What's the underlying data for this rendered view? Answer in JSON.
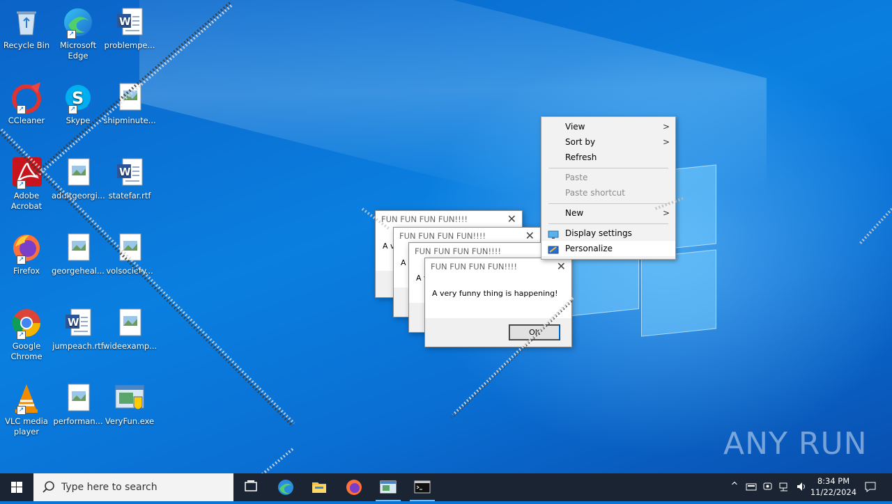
{
  "desktop_icons": [
    {
      "id": "recycle-bin",
      "label": "Recycle Bin",
      "icon": "recycle-bin-icon",
      "shortcut": false
    },
    {
      "id": "edge",
      "label": "Microsoft Edge",
      "icon": "edge-icon",
      "shortcut": true
    },
    {
      "id": "problempe",
      "label": "problempe...",
      "icon": "word-doc-icon",
      "shortcut": false
    },
    {
      "id": "ccleaner",
      "label": "CCleaner",
      "icon": "ccleaner-icon",
      "shortcut": true
    },
    {
      "id": "skype",
      "label": "Skype",
      "icon": "skype-icon",
      "shortcut": true
    },
    {
      "id": "shipminute",
      "label": "shipminute...",
      "icon": "image-file-icon",
      "shortcut": false
    },
    {
      "id": "acrobat",
      "label": "Adobe Acrobat",
      "icon": "acrobat-icon",
      "shortcut": true
    },
    {
      "id": "adultgeorgi",
      "label": "adultgeorgi...",
      "icon": "image-file-icon",
      "shortcut": false
    },
    {
      "id": "statefar",
      "label": "statefar.rtf",
      "icon": "word-doc-icon",
      "shortcut": false
    },
    {
      "id": "firefox",
      "label": "Firefox",
      "icon": "firefox-icon",
      "shortcut": true
    },
    {
      "id": "georgeheal",
      "label": "georgeheal...",
      "icon": "image-file-icon",
      "shortcut": false
    },
    {
      "id": "volsociety",
      "label": "volsociety...",
      "icon": "image-file-icon",
      "shortcut": false
    },
    {
      "id": "chrome",
      "label": "Google Chrome",
      "icon": "chrome-icon",
      "shortcut": true
    },
    {
      "id": "jumpeach",
      "label": "jumpeach.rtf",
      "icon": "word-doc-icon",
      "shortcut": false
    },
    {
      "id": "wideexamp",
      "label": "wideexamp...",
      "icon": "image-file-icon",
      "shortcut": false
    },
    {
      "id": "vlc",
      "label": "VLC media player",
      "icon": "vlc-icon",
      "shortcut": true
    },
    {
      "id": "performan",
      "label": "performan...",
      "icon": "image-file-icon",
      "shortcut": false
    },
    {
      "id": "veryfun",
      "label": "VeryFun.exe",
      "icon": "exe-icon",
      "shortcut": false
    }
  ],
  "dialogs": [
    {
      "title": "FUN FUN FUN FUN!!!!",
      "message": "A v"
    },
    {
      "title": "FUN FUN FUN FUN!!!!",
      "message": "A v"
    },
    {
      "title": "FUN FUN FUN FUN!!!!",
      "message": "A v"
    },
    {
      "title": "FUN FUN FUN FUN!!!!",
      "message": "A very funny thing is happening!",
      "ok_label": "OK"
    }
  ],
  "context_menu": {
    "items": [
      {
        "label": "View",
        "submenu": true,
        "disabled": false
      },
      {
        "label": "Sort by",
        "submenu": true,
        "disabled": false
      },
      {
        "label": "Refresh",
        "submenu": false,
        "disabled": false
      },
      {
        "label": "Paste",
        "submenu": false,
        "disabled": true
      },
      {
        "label": "Paste shortcut",
        "submenu": false,
        "disabled": true
      },
      {
        "label": "New",
        "submenu": true,
        "disabled": false
      },
      {
        "label": "Display settings",
        "submenu": false,
        "disabled": false,
        "icon": "monitor-icon"
      },
      {
        "label": "Personalize",
        "submenu": false,
        "disabled": false,
        "icon": "personalize-icon",
        "highlighted": true
      }
    ]
  },
  "taskbar": {
    "search_placeholder": "Type here to search",
    "apps": [
      "task-view-icon",
      "edge-icon",
      "file-explorer-icon",
      "firefox-icon",
      "veryfun-app-icon",
      "cmd-icon"
    ],
    "time": "8:34 PM",
    "date": "11/22/2024"
  },
  "watermark": "ANY RUN",
  "colors": {
    "accent": "#0078d7",
    "taskbar": "#1b2432"
  }
}
